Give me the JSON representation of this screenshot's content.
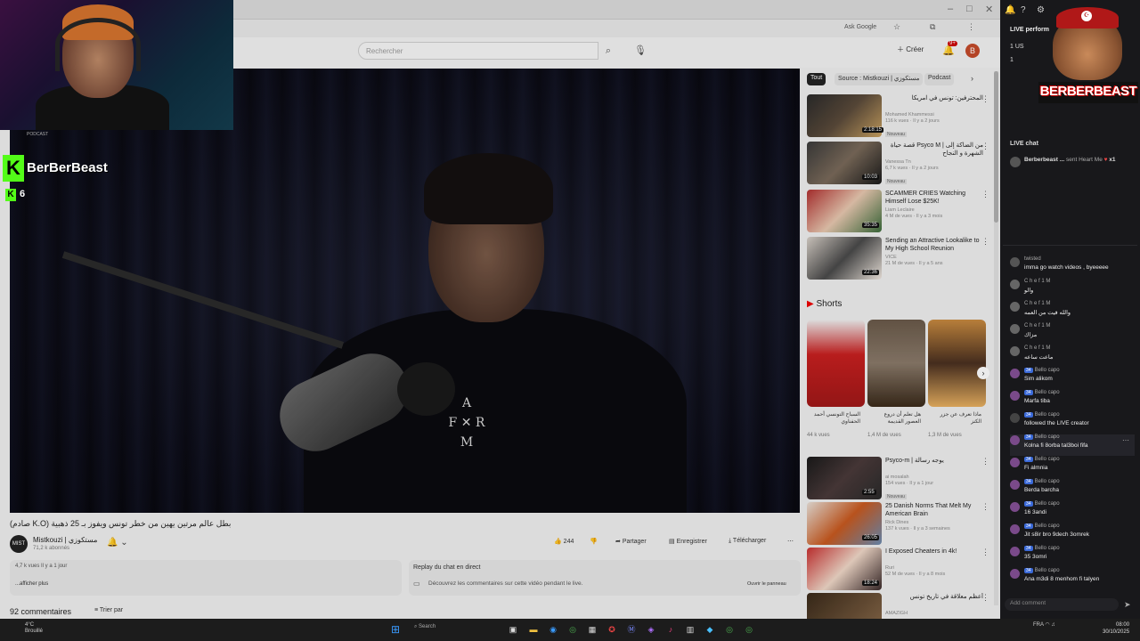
{
  "browser": {
    "ask_google": "Ask Google",
    "search_placeholder": "Rechercher",
    "create_label": "Créer",
    "notif_badge": "9+",
    "avatar_letter": "B"
  },
  "video": {
    "logo_top": "A",
    "logo_left": "F",
    "logo_right": "R",
    "logo_bottom": "M",
    "title": "بطل عالم مرتين يهين من خطر تونس ويفوز بـ 25 ذهبية (K.O صادم)",
    "channel_name": "Mistkouzi | مستكوزي",
    "channel_subs": "71,2 k abonnés",
    "channel_avatar_text": "MIST",
    "likes": "244",
    "share": "Partager",
    "save": "Enregistrer",
    "download": "Télécharger",
    "desc_meta": "4,7 k vues  Il y a 1 jour",
    "desc_more": "...afficher plus",
    "chat_replay_title": "Replay du chat en direct",
    "chat_replay_desc": "Découvrez les commentaires sur cette vidéo pendant le live.",
    "chat_replay_open": "Ouvrir le panneau",
    "comments_count": "92 commentaires",
    "sort_by": "Trier par"
  },
  "chips": {
    "all": "Tout",
    "source": "Source : Mistkouzi | مستكوزي",
    "podcast": "Podcast"
  },
  "recommendations": [
    {
      "title": "المحترفين: تونس في امريكا",
      "channel": "Mohamed Khammessi",
      "meta": "116 k vues · Il y a 2 jours",
      "duration": "2:18:15",
      "badge": "Nouveau"
    },
    {
      "title": "قصة حياة Psyco M | من الضاكة إلى الشهرة و النجاح",
      "channel": "Vanessa Tn",
      "meta": "6,7 k vues · Il y a 2 jours",
      "duration": "10:03",
      "badge": "Nouveau"
    },
    {
      "title": "SCAMMER CRIES Watching Himself Lose $25K!",
      "channel": "Liam Leclaire",
      "meta": "4 M de vues · Il y a 3 mois",
      "duration": "35:35",
      "badge": ""
    },
    {
      "title": "Sending an Attractive Lookalike to My High School Reunion",
      "channel": "VICE",
      "meta": "21 M de vues · Il y a 5 ans",
      "duration": "22:36",
      "badge": ""
    }
  ],
  "shorts": {
    "heading": "Shorts",
    "items": [
      {
        "title": "السباح التونسي أحمد الحفناوي",
        "views": "44 k vues"
      },
      {
        "title": "هل تعلم أن دروع العصور القديمة",
        "views": "1,4 M de vues"
      },
      {
        "title": "ماذا تعرف عن جزر الكنز",
        "views": "1,3 M de vues"
      }
    ]
  },
  "recommendations2": [
    {
      "title": "Psyco-m | يوجه رسالة",
      "channel": "ai mosalah",
      "meta": "154 vues · Il y a 1 jour",
      "duration": "2:55",
      "badge": "Nouveau"
    },
    {
      "title": "25 Danish Norms That Melt My American Brain",
      "channel": "Rick Dines",
      "meta": "137 k vues · Il y a 3 semaines",
      "duration": "26:05",
      "badge": ""
    },
    {
      "title": "I Exposed Cheaters in 4k!",
      "channel": "Ruri",
      "meta": "52 M de vues · Il y a 8 mois",
      "duration": "18:24",
      "badge": ""
    },
    {
      "title": "أعظم معلاقة في تاريخ تونس",
      "channel": "AMAZIGH",
      "meta": "",
      "duration": "",
      "badge": ""
    }
  ],
  "stream": {
    "brand": "BerBerBeast",
    "podcast_label": "PODCAST",
    "kick_letter": "K",
    "viewers": "6",
    "logo_text": "BERBERBEAST",
    "live_performance": "LIVE perform",
    "perf_row1": "1  US",
    "perf_row2": "1",
    "live_chat": "LIVE chat",
    "pinned_user": "Berberbeast ...",
    "pinned_text": "sent Heart Me",
    "pinned_count": "x1",
    "add_comment": "Add comment"
  },
  "chat_messages": [
    {
      "user": "twisted",
      "text": "imma go watch videos , byeeeee",
      "badge": ""
    },
    {
      "user": "C h e f  1 M",
      "text": "والو",
      "badge": ""
    },
    {
      "user": "C h e f  1 M",
      "text": "والله فيت من العمه",
      "badge": ""
    },
    {
      "user": "C h e f  1 M",
      "text": "مزاك",
      "badge": ""
    },
    {
      "user": "C h e f  1 M",
      "text": "ماعت ساعه",
      "badge": ""
    },
    {
      "user": "Bello capo",
      "text": "Sim alikom",
      "badge": "34"
    },
    {
      "user": "Bello capo",
      "text": "Marfa tiba",
      "badge": "34"
    },
    {
      "user": "Bello capo",
      "text": "followed the LIVE creator",
      "badge": "34"
    },
    {
      "user": "Bello capo",
      "text": "Kolna fi 8orba tal3boi fifa",
      "badge": "34"
    },
    {
      "user": "Bello capo",
      "text": "Fi almnia",
      "badge": "34"
    },
    {
      "user": "Bello capo",
      "text": "Berda barcha",
      "badge": "34"
    },
    {
      "user": "Bello capo",
      "text": "16 3andi",
      "badge": "34"
    },
    {
      "user": "Bello capo",
      "text": "Jit s8ir bro 9dech 3omrek",
      "badge": "34"
    },
    {
      "user": "Bello capo",
      "text": "35 3omri",
      "badge": "34"
    },
    {
      "user": "Bello capo",
      "text": "Ana m3di 8 menhom fi talyen",
      "badge": "34"
    }
  ],
  "taskbar": {
    "weather_temp": "4°C",
    "weather_desc": "Brouillé",
    "search": "Search",
    "time": "08:00",
    "date": "30/10/2025",
    "lang": "FRA"
  },
  "colors": {
    "kick_green": "#53fc18",
    "chat_bg": "#18181b",
    "accent_red": "#cc0000"
  }
}
